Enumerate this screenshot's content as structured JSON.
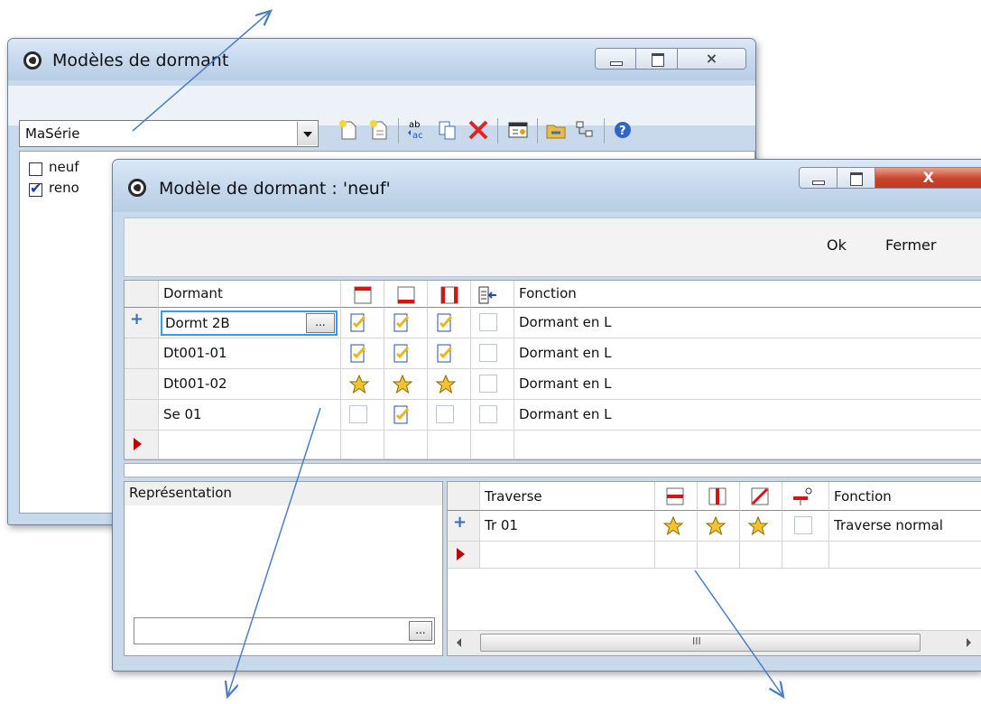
{
  "back_window": {
    "title": "Modèles de dormant",
    "series_combo": {
      "value": "MaSérie"
    },
    "toolbar_icons": [
      "new-doc-icon",
      "new-copy-icon",
      "rename-icon",
      "copy-icon",
      "delete-icon",
      "properties-icon",
      "link-icon",
      "hierarchy-icon",
      "help-icon"
    ],
    "list": [
      {
        "label": "neuf",
        "checked": false
      },
      {
        "label": "reno",
        "checked": true
      }
    ]
  },
  "front_window": {
    "title": "Modèle de dormant : 'neuf'",
    "actions": {
      "ok_label": "Ok",
      "close_label": "Fermer"
    },
    "dormant_grid": {
      "col_name_header": "Dormant",
      "col_function_header": "Fonction",
      "header_icons": [
        "top-frame-icon",
        "bottom-frame-icon",
        "side-frame-icon",
        "insert-icon"
      ],
      "rows": [
        {
          "name": "Dormt 2B",
          "marks": [
            "edit",
            "edit",
            "edit",
            "none"
          ],
          "function": "Dormant en L",
          "marker": "+"
        },
        {
          "name": "Dt001-01",
          "marks": [
            "edit",
            "edit",
            "edit",
            "none"
          ],
          "function": "Dormant en L",
          "marker": ""
        },
        {
          "name": "Dt001-02",
          "marks": [
            "star",
            "star",
            "star",
            "none"
          ],
          "function": "Dormant en L",
          "marker": ""
        },
        {
          "name": "Se 01",
          "marks": [
            "none",
            "edit",
            "none",
            "none"
          ],
          "function": "Dormant en L",
          "marker": ""
        }
      ],
      "ellipsis": "..."
    },
    "representation_label": "Représentation",
    "representation_button": "...",
    "traverse_grid": {
      "col_name_header": "Traverse",
      "col_function_header": "Fonction",
      "header_icons": [
        "horizontal-bar-icon",
        "vertical-bar-icon",
        "diagonal-bar-icon",
        "stop-icon"
      ],
      "rows": [
        {
          "name": "Tr 01",
          "marks": [
            "star",
            "star",
            "star",
            "none"
          ],
          "function": "Traverse normal",
          "marker": "+"
        }
      ],
      "scroll_grip": "III"
    }
  }
}
